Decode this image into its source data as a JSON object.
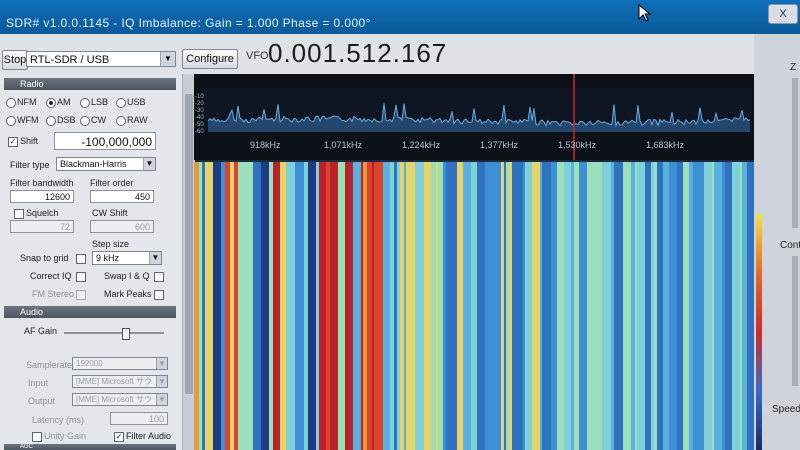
{
  "window": {
    "title": "SDR# v1.0.0.1145 - IQ Imbalance: Gain = 1.000 Phase = 0.000°",
    "close_label": "X"
  },
  "toolbar": {
    "stop_label": "Stop",
    "device_value": "RTL-SDR / USB",
    "configure_label": "Configure",
    "vfo_label": "VFO",
    "vfo_value": "0.001.512.167"
  },
  "radio": {
    "header": "Radio",
    "modes": [
      {
        "label": "NFM",
        "selected": false
      },
      {
        "label": "AM",
        "selected": true
      },
      {
        "label": "LSB",
        "selected": false
      },
      {
        "label": "USB",
        "selected": false
      },
      {
        "label": "WFM",
        "selected": false
      },
      {
        "label": "DSB",
        "selected": false
      },
      {
        "label": "CW",
        "selected": false
      },
      {
        "label": "RAW",
        "selected": false
      }
    ],
    "shift_label": "Shift",
    "shift_checked": true,
    "shift_value": "-100,000,000",
    "filter_type_label": "Filter type",
    "filter_type_value": "Blackman-Harris",
    "filter_bandwidth_label": "Filter bandwidth",
    "filter_bandwidth_value": "12600",
    "filter_order_label": "Filter order",
    "filter_order_value": "450",
    "squelch_label": "Squelch",
    "squelch_value": "72",
    "cw_shift_label": "CW Shift",
    "cw_shift_value": "600",
    "step_size_label": "Step size",
    "step_size_value": "9 kHz",
    "snap_label": "Snap to grid",
    "correct_iq_label": "Correct IQ",
    "swap_iq_label": "Swap I & Q",
    "fm_stereo_label": "FM Stereo",
    "mark_peaks_label": "Mark Peaks"
  },
  "audio": {
    "header": "Audio",
    "af_gain_label": "AF Gain",
    "af_gain_level": 0.4,
    "samplerate_label": "Samplerate",
    "samplerate_value": "192000",
    "input_label": "Input",
    "input_value": "[MME] Microsoft サウ",
    "output_label": "Output",
    "output_value": "[MME] Microsoft サウ",
    "latency_label": "Latency (ms)",
    "latency_value": "100",
    "unity_gain_label": "Unity Gain",
    "filter_audio_label": "Filter Audio",
    "filter_audio_checked": true,
    "agc_header": "AGC"
  },
  "spectrum": {
    "db_ticks": [
      "-10",
      "-20",
      "-30",
      "-40",
      "-50",
      "-60"
    ],
    "freq_ticks": [
      "918kHz",
      "1,071kHz",
      "1,224kHz",
      "1,377kHz",
      "1,530kHz",
      "1,683kHz"
    ],
    "trace_color": "#6fa9df",
    "cursor_color": "#e02020"
  },
  "right_panel": {
    "label_contrast": "Cont",
    "label_speed": "Speed",
    "label_z": "Z"
  }
}
